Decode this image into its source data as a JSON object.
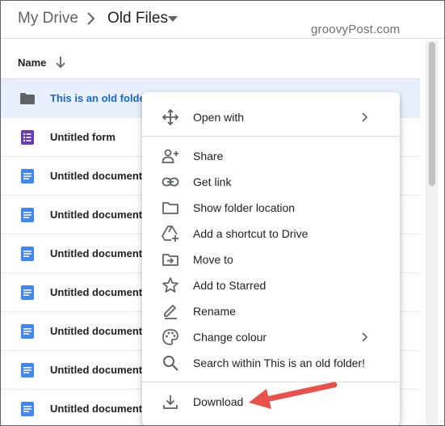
{
  "breadcrumb": {
    "root": "My Drive",
    "current": "Old Files"
  },
  "watermark": "groovyPost.com",
  "list_header": {
    "name_label": "Name"
  },
  "files": [
    {
      "name": "This is an old folder!",
      "type": "folder",
      "selected": true
    },
    {
      "name": "Untitled form",
      "type": "form"
    },
    {
      "name": "Untitled document",
      "type": "document"
    },
    {
      "name": "Untitled document",
      "type": "document"
    },
    {
      "name": "Untitled document",
      "type": "document"
    },
    {
      "name": "Untitled document",
      "type": "document"
    },
    {
      "name": "Untitled document",
      "type": "document"
    },
    {
      "name": "Untitled document",
      "type": "document"
    },
    {
      "name": "Untitled document",
      "type": "document"
    }
  ],
  "context_menu": {
    "items": [
      {
        "label": "Open with",
        "icon": "move-arrows-icon",
        "submenu": true
      },
      {
        "label": "Share",
        "icon": "person-add-icon"
      },
      {
        "label": "Get link",
        "icon": "link-icon"
      },
      {
        "label": "Show folder location",
        "icon": "folder-outline-icon"
      },
      {
        "label": "Add a shortcut to Drive",
        "icon": "drive-shortcut-icon"
      },
      {
        "label": "Move to",
        "icon": "move-to-folder-icon"
      },
      {
        "label": "Add to Starred",
        "icon": "star-outline-icon"
      },
      {
        "label": "Rename",
        "icon": "pencil-icon"
      },
      {
        "label": "Change colour",
        "icon": "palette-icon",
        "submenu": true
      },
      {
        "label": "Search within This is an old folder!",
        "icon": "search-icon"
      },
      {
        "label": "Download",
        "icon": "download-icon"
      }
    ]
  },
  "colors": {
    "selected_row_bg": "#e8f0fe",
    "selected_text": "#1967d2",
    "folder_icon": "#5f6368",
    "form_icon": "#673ab7",
    "document_icon": "#4285f4",
    "annotation_arrow": "#e8524a"
  }
}
